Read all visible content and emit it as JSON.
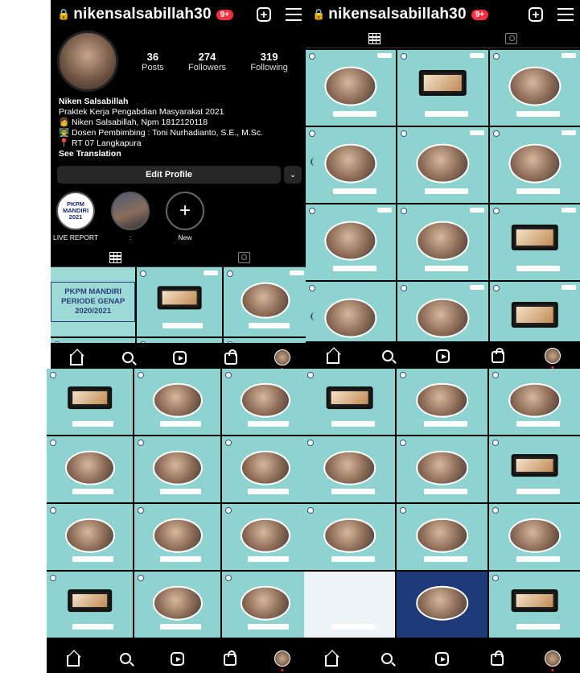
{
  "profile": {
    "username": "nikensalsabillah30",
    "notif_badge": "9+",
    "stats": [
      {
        "num": "36",
        "label": "Posts"
      },
      {
        "num": "274",
        "label": "Followers"
      },
      {
        "num": "319",
        "label": "Following"
      }
    ],
    "bio": {
      "name": "Niken Salsabillah",
      "line1": "Praktek Kerja Pengabdian Masyarakat 2021",
      "line2": "👩 Niken Salsabillah, Npm 1812120118",
      "line3": "👨‍🏫 Dosen Pembimbing : Toni Nurhadianto, S.E., M.Sc.",
      "line4": "📍 RT 07 Langkapura",
      "see_translation": "See Translation"
    },
    "edit_profile": "Edit Profile",
    "chevron": "⌄"
  },
  "highlights": [
    {
      "label": "LIVE REPORT",
      "logo_text": "PKPM MANDIRI 2021"
    },
    {
      "label": ":"
    },
    {
      "label": "New",
      "plus": "+"
    }
  ],
  "cover_post": {
    "text": "PKPM MANDIRI PERIODE GENAP 2020/2021"
  },
  "icons": {
    "lock": "🔒",
    "plus": "+",
    "camera": "📷"
  },
  "colors": {
    "tile_teal": "#8ed3cf",
    "badge_red": "#ff2f40",
    "background": "#000000"
  }
}
